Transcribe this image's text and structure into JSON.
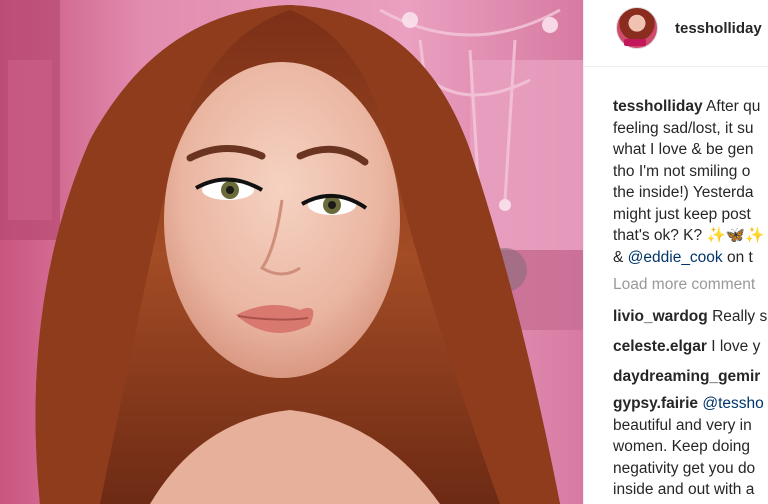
{
  "post": {
    "username": "tessholliday",
    "caption": {
      "username": "tessholliday",
      "line1": "After qu",
      "line2": "feeling sad/lost, it su",
      "line3": "what I love & be gen",
      "line4": "tho I'm not smiling o",
      "line5": "the inside!) Yesterda",
      "line6": "might just keep post",
      "line7": "that's ok? K?",
      "line7_emoji": "✨🦋✨",
      "line8_prefix": "&",
      "mention": "@eddie_cook",
      "line8_suffix": "on t"
    },
    "load_more": "Load more comment",
    "comments": [
      {
        "user": "livio_wardog",
        "text": "Really s"
      },
      {
        "user": "celeste.elgar",
        "text": "I love y"
      },
      {
        "user": "daydreaming_gemir",
        "text": ""
      },
      {
        "user": "gypsy.fairie",
        "mention": "@tessho",
        "lines": [
          "beautiful and very in",
          "women. Keep doing",
          "negativity get you do",
          "inside and out with a"
        ]
      }
    ]
  },
  "icons": {
    "avatar": "profile-avatar-icon"
  },
  "colors": {
    "link": "#003569",
    "muted": "#999999",
    "wall": "#e08fb1",
    "hair": "#8b3a1e"
  }
}
